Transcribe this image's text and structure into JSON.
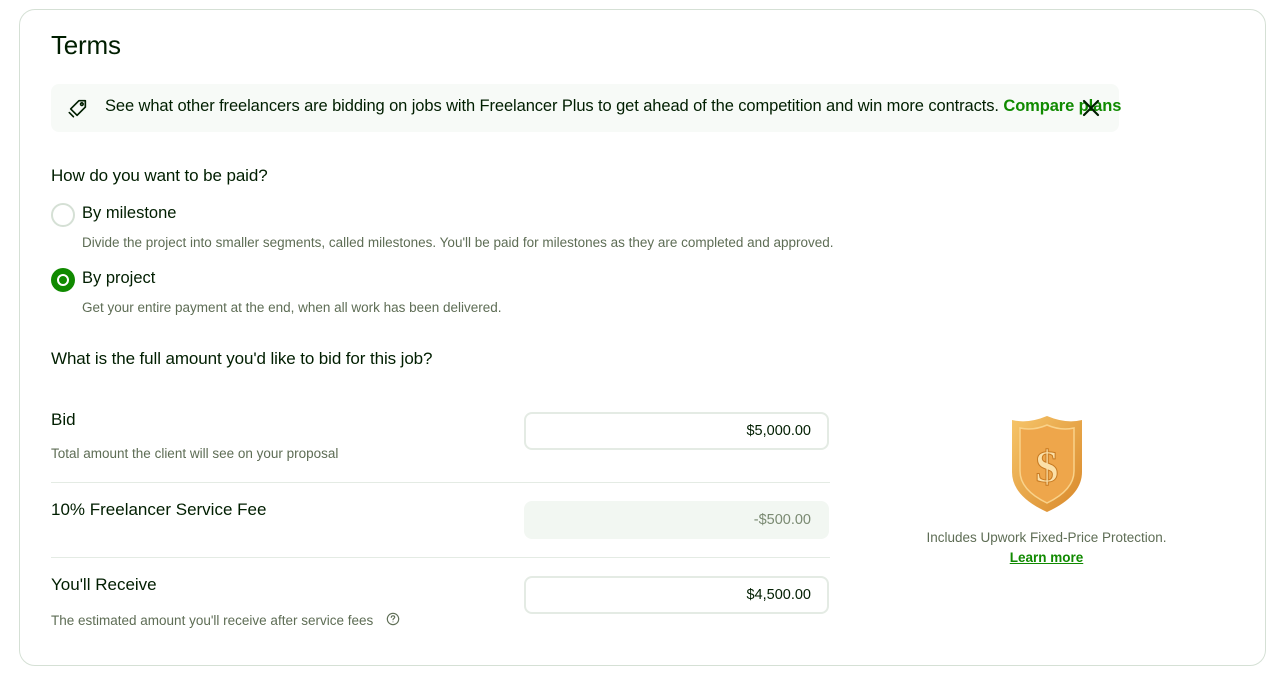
{
  "section": {
    "title": "Terms"
  },
  "banner": {
    "message": "See what other freelancers are bidding on jobs with Freelancer Plus to get ahead of the competition and win more contracts.",
    "link_label": "Compare plans",
    "icon": "tag-icon",
    "close_icon": "close-icon"
  },
  "payment": {
    "question": "How do you want to be paid?",
    "options": [
      {
        "label": "By milestone",
        "description": "Divide the project into smaller segments, called milestones. You'll be paid for milestones as they are completed and approved.",
        "selected": false
      },
      {
        "label": "By project",
        "description": "Get your entire payment at the end, when all work has been delivered.",
        "selected": true
      }
    ]
  },
  "bid": {
    "question": "What is the full amount you'd like to bid for this job?",
    "bid_label": "Bid",
    "bid_sub": "Total amount the client will see on your proposal",
    "bid_value": "$5,000.00",
    "fee_label": "10% Freelancer Service Fee",
    "fee_value": "-$500.00",
    "receive_label": "You'll Receive",
    "receive_sub": "The estimated amount you'll receive after service fees",
    "receive_value": "$4,500.00",
    "help_icon": "question-circle-icon"
  },
  "protection": {
    "icon": "dollar-shield-icon",
    "text": "Includes Upwork Fixed-Price Protection.",
    "link_label": "Learn more"
  },
  "colors": {
    "accent": "#108a00",
    "text": "#001e00",
    "muted": "#5e6d55",
    "shield": "#e8a33d"
  }
}
